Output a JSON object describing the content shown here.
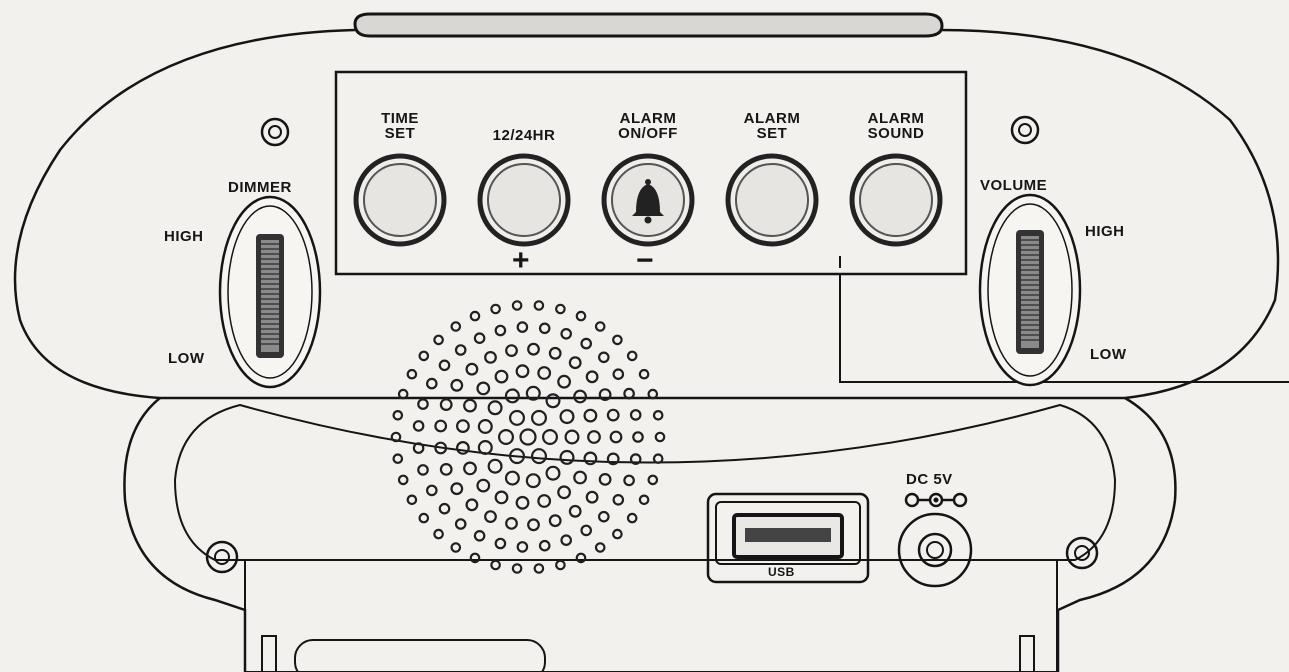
{
  "buttons": [
    {
      "line1": "TIME",
      "line2": "SET"
    },
    {
      "line1": "12/24HR",
      "line2": ""
    },
    {
      "line1": "ALARM",
      "line2": "ON/OFF"
    },
    {
      "line1": "ALARM",
      "line2": "SET"
    },
    {
      "line1": "ALARM",
      "line2": "SOUND"
    }
  ],
  "plus_sign": "+",
  "minus_sign": "−",
  "dimmer": {
    "title": "DIMMER",
    "high": "HIGH",
    "low": "LOW"
  },
  "volume": {
    "title": "VOLUME",
    "high": "HIGH",
    "low": "LOW"
  },
  "usb_label": "USB",
  "dc_label": "DC 5V",
  "alarm_button_icon": "bell-icon",
  "colors": {
    "line": "#151515",
    "paper": "#f2f1ee",
    "button_ring": "#2a2a2a"
  }
}
